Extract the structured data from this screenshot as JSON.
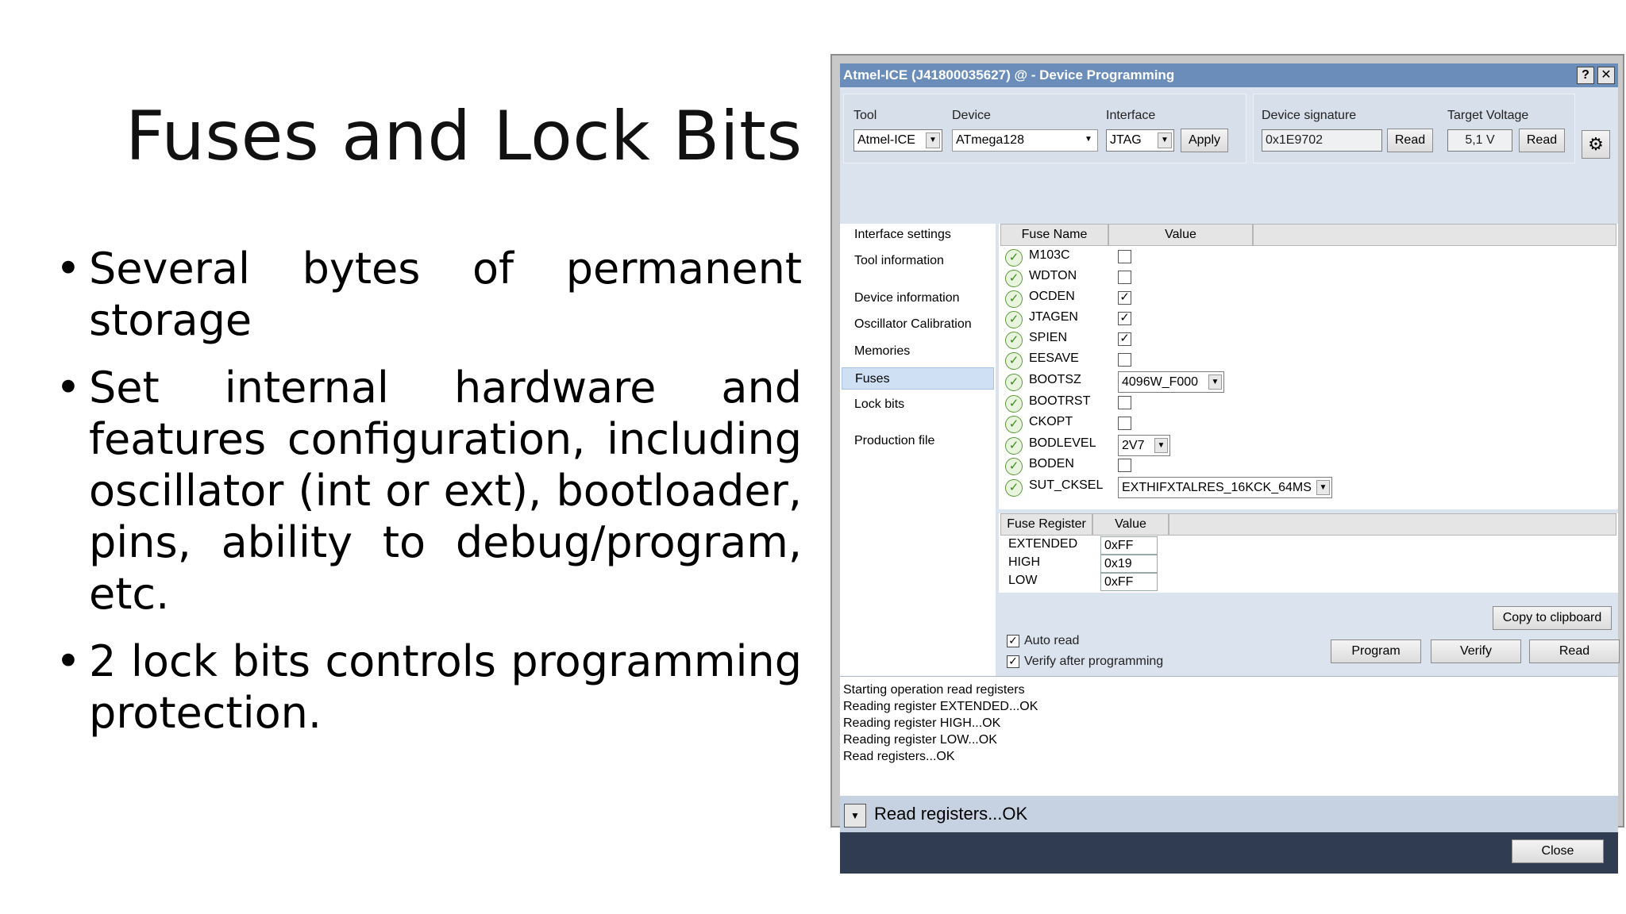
{
  "slide": {
    "title": "Fuses and Lock Bits",
    "bullets": [
      "Several bytes of permanent storage",
      "Set internal hardware and features configuration, including oscillator (int or ext), bootloader, pins, ability to debug/program, etc.",
      "2 lock bits controls programming protection."
    ]
  },
  "window": {
    "title": "Atmel-ICE (J41800035627) @  - Device Programming",
    "help_label": "?",
    "close_label": "✕"
  },
  "toolbar": {
    "tool_label": "Tool",
    "tool_value": "Atmel-ICE",
    "device_label": "Device",
    "device_value": "ATmega128",
    "interface_label": "Interface",
    "interface_value": "JTAG",
    "apply_label": "Apply",
    "signature_label": "Device signature",
    "signature_value": "0x1E9702",
    "signature_read": "Read",
    "voltage_label": "Target Voltage",
    "voltage_value": "5,1 V",
    "voltage_read": "Read"
  },
  "nav": {
    "items": [
      "Interface settings",
      "Tool information",
      "Device information",
      "Oscillator Calibration",
      "Memories",
      "Fuses",
      "Lock bits",
      "Production file"
    ]
  },
  "fuses": {
    "col_name": "Fuse Name",
    "col_value": "Value",
    "rows": [
      {
        "name": "M103C",
        "checked": false
      },
      {
        "name": "WDTON",
        "checked": false
      },
      {
        "name": "OCDEN",
        "checked": true
      },
      {
        "name": "JTAGEN",
        "checked": true
      },
      {
        "name": "SPIEN",
        "checked": true
      },
      {
        "name": "EESAVE",
        "checked": false
      },
      {
        "name": "BOOTSZ",
        "value": "4096W_F000"
      },
      {
        "name": "BOOTRST",
        "checked": false
      },
      {
        "name": "CKOPT",
        "checked": false
      },
      {
        "name": "BODLEVEL",
        "value": "2V7"
      },
      {
        "name": "BODEN",
        "checked": false
      },
      {
        "name": "SUT_CKSEL",
        "value": "EXTHIFXTALRES_16KCK_64MS"
      }
    ],
    "check_mark": "✓"
  },
  "registers": {
    "col_name": "Fuse Register",
    "col_value": "Value",
    "rows": [
      {
        "name": "EXTENDED",
        "value": "0xFF"
      },
      {
        "name": "HIGH",
        "value": "0x19"
      },
      {
        "name": "LOW",
        "value": "0xFF"
      }
    ]
  },
  "options": {
    "copy_label": "Copy to clipboard",
    "auto_read_label": "Auto read",
    "verify_label": "Verify after programming",
    "program_label": "Program",
    "verify_btn_label": "Verify",
    "read_label": "Read"
  },
  "log": [
    "Starting operation read registers",
    "Reading register EXTENDED...OK",
    "Reading register HIGH...OK",
    "Reading register LOW...OK",
    "Read registers...OK"
  ],
  "status": {
    "text": "Read registers...OK",
    "close_label": "Close"
  }
}
